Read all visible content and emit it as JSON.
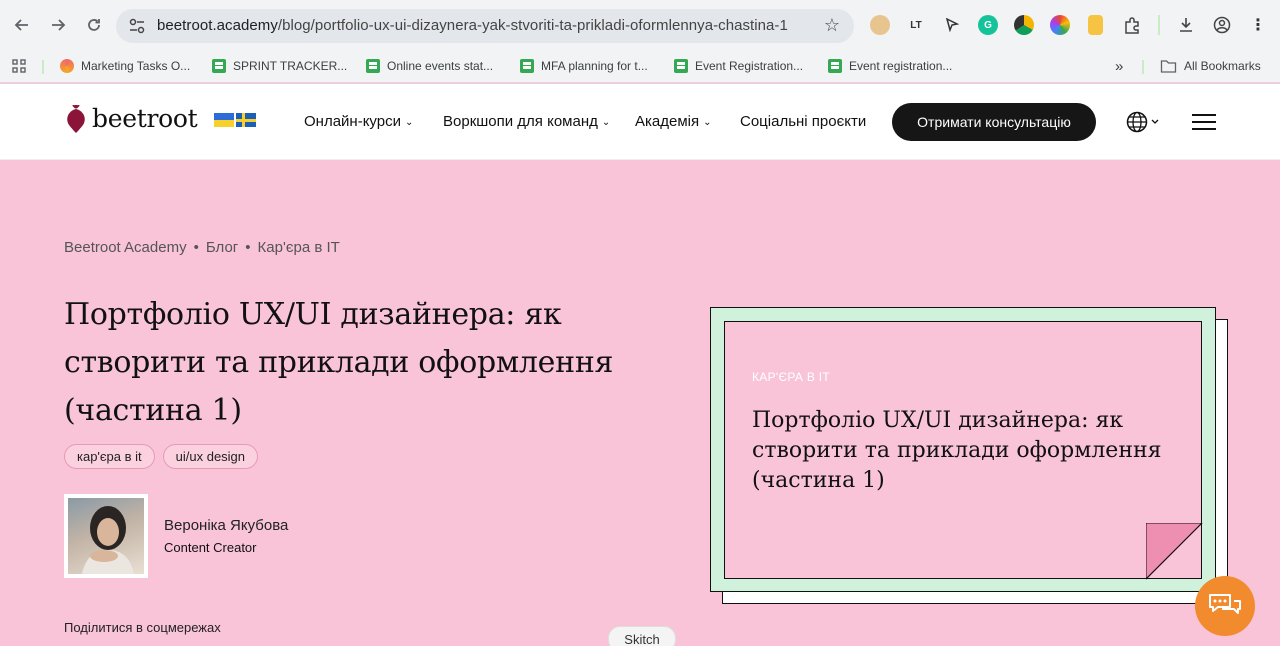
{
  "browser": {
    "url_host": "beetroot.academy",
    "url_path": "/blog/portfolio-ux-ui-dizaynera-yak-stvoriti-ta-prikladi-oformlennya-chastina-1",
    "extensions": [
      "cookie-icon",
      "lt-icon",
      "cursor-icon",
      "grammarly-icon",
      "drive-icon",
      "colorwheel-icon",
      "docs-icon",
      "puzzle-icon"
    ],
    "bookmarks": [
      {
        "label": "Marketing Tasks O...",
        "icon": "asana-icon"
      },
      {
        "label": "SPRINT TRACKER...",
        "icon": "sheet-icon"
      },
      {
        "label": "Online events stat...",
        "icon": "sheet-icon"
      },
      {
        "label": "MFA planning for t...",
        "icon": "sheet-icon"
      },
      {
        "label": "Event Registration...",
        "icon": "sheet-icon"
      },
      {
        "label": "Event registration...",
        "icon": "sheet-icon"
      }
    ],
    "more_bookmarks": "»",
    "all_bookmarks": "All Bookmarks"
  },
  "site": {
    "logo": "beetroot",
    "nav": [
      {
        "label": "Онлайн-курси",
        "dropdown": true
      },
      {
        "label": "Воркшопи для команд",
        "dropdown": true
      },
      {
        "label": "Академія",
        "dropdown": true
      },
      {
        "label": "Соціальні проєкти",
        "dropdown": false
      }
    ],
    "cta": "Отримати консультацію"
  },
  "article": {
    "breadcrumb": [
      "Beetroot Academy",
      "Блог",
      "Кар'єра в IT"
    ],
    "title": "Портфоліо UX/UI дизайнера: як створити та приклади оформлення (частина 1)",
    "tags": [
      "кар'єра в it",
      "ui/ux design"
    ],
    "author_name": "Вероніка Якубова",
    "author_role": "Content Creator",
    "share_label": "Поділитися в соцмережах",
    "card_category": "КАР'ЄРА В IT",
    "card_title": "Портфоліо UX/UI дизайнера: як створити та приклади оформлення  (частина 1)"
  },
  "overlay": {
    "skitch": "Skitch"
  },
  "colors": {
    "page_bg": "#fac4d8",
    "card_green": "#d0f2dc",
    "cta_bg": "#161616",
    "chat_orange": "#f28a2e",
    "fold_pink": "#ee8fb2"
  }
}
